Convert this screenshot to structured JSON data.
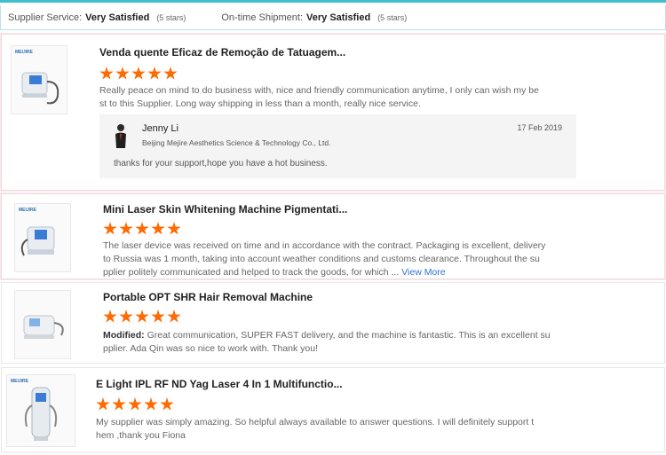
{
  "summary": {
    "supplier_service_label": "Supplier Service:",
    "supplier_service_value": "Very Satisfied",
    "supplier_service_stars": "(5 stars)",
    "shipment_label": "On-time Shipment:",
    "shipment_value": "Very Satisfied",
    "shipment_stars": "(5 stars)"
  },
  "brand_logo": "MEIJIRE",
  "reviews": [
    {
      "title": "Venda quente Eficaz de Remoção de Tatuagem...",
      "rating": 5,
      "text_line1": "Really peace on mind to do business with, nice and friendly communication anytime, I only can wish my be",
      "text_line2": "st to this Supplier. Long way shipping in less than a month, really nice service.",
      "reply": {
        "name": "Jenny Li",
        "company": "Beijing Mejire Aesthetics Science & Technology Co., Ltd.",
        "date": "17 Feb 2019",
        "text": "thanks for your support,hope you have a hot business."
      }
    },
    {
      "title": "Mini Laser Skin Whitening Machine Pigmentati...",
      "rating": 5,
      "text_line1": "The laser device was received on time and in accordance with the contract. Packaging is excellent, delivery",
      "text_line2": "to Russia was 1 month, taking into account weather conditions and customs clearance. Throughout the su",
      "text_line3": "pplier politely communicated and helped to track the goods, for which ...",
      "view_more": "View More"
    },
    {
      "title": "Portable OPT SHR Hair Removal Machine",
      "rating": 5,
      "modified_label": "Modified:",
      "text_line1": "Great communication, SUPER FAST delivery, and the machine is fantastic. This is an excellent su",
      "text_line2": "pplier. Ada Qin was so nice to work with. Thank you!"
    },
    {
      "title": "E Light IPL RF ND Yag Laser 4 In 1 Multifunctio...",
      "rating": 5,
      "text_line1": "My supplier was simply amazing. So helpful always available to answer questions. I will definitely support t",
      "text_line2": "hem ,thank you Fiona"
    }
  ]
}
